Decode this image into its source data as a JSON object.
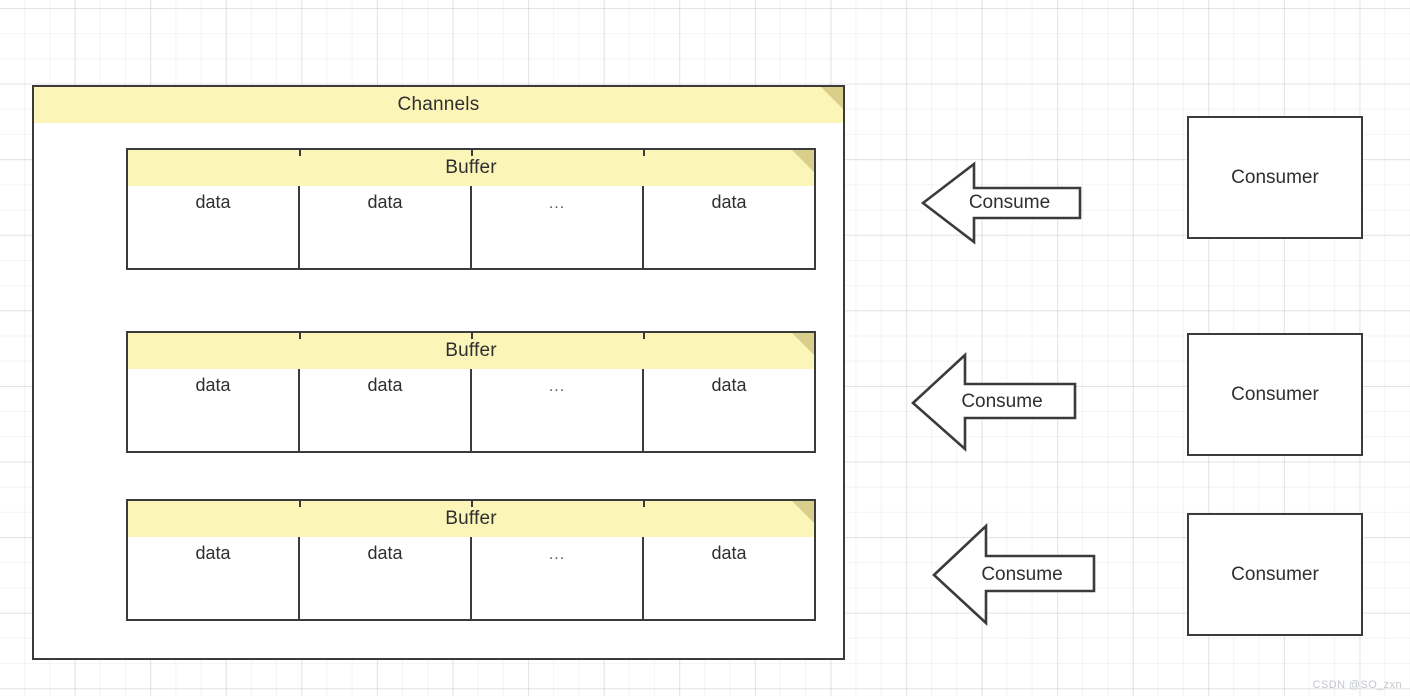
{
  "diagram": {
    "title": "Channels",
    "container": {
      "label": "Channels",
      "fold_color": "#d9cf8a",
      "header_color": "#fcf5b8",
      "border_color": "#3b3b3b"
    },
    "buffers": [
      {
        "label": "Buffer",
        "cells": [
          "data",
          "data",
          "...",
          "data"
        ]
      },
      {
        "label": "Buffer",
        "cells": [
          "data",
          "data",
          "...",
          "data"
        ]
      },
      {
        "label": "Buffer",
        "cells": [
          "data",
          "data",
          "...",
          "data"
        ]
      }
    ],
    "arrows": [
      {
        "label": "Consume",
        "direction": "left"
      },
      {
        "label": "Consume",
        "direction": "left"
      },
      {
        "label": "Consume",
        "direction": "left"
      }
    ],
    "consumers": [
      {
        "label": "Consumer"
      },
      {
        "label": "Consumer"
      },
      {
        "label": "Consumer"
      }
    ]
  },
  "watermark": {
    "text": "CSDN @SO_zxn"
  }
}
